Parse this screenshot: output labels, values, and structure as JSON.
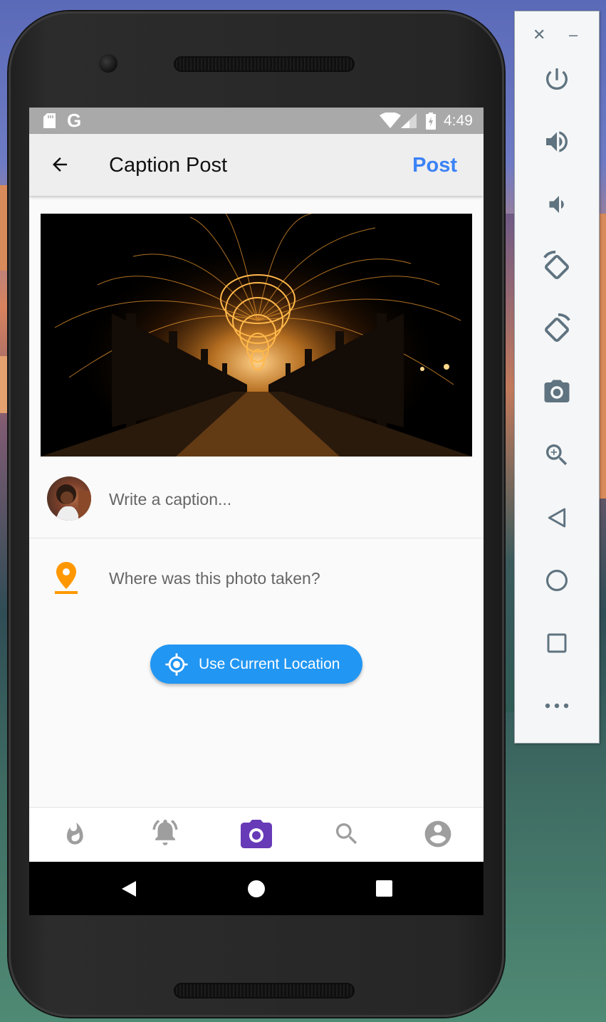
{
  "status_bar": {
    "carrier_icon": "G",
    "time": "4:49"
  },
  "app_bar": {
    "title": "Caption Post",
    "post_label": "Post"
  },
  "caption": {
    "placeholder": "Write a caption..."
  },
  "location": {
    "placeholder": "Where was this photo taken?",
    "current_location_label": "Use Current Location"
  },
  "bottom_nav": {
    "items": [
      "flame-icon",
      "bell-icon",
      "camera-icon",
      "search-icon",
      "account-icon"
    ],
    "active": "camera-icon",
    "active_color": "#673ab7",
    "inactive_color": "#9e9e9e"
  },
  "colors": {
    "accent_blue": "#2196f3",
    "post_blue": "#3b82f6",
    "pin_orange": "#ff9800"
  },
  "emulator_toolbar": {
    "items": [
      "close-icon",
      "minimize-icon",
      "power-icon",
      "volume-up-icon",
      "volume-down-icon",
      "rotate-left-icon",
      "rotate-right-icon",
      "screenshot-icon",
      "zoom-icon",
      "back-icon",
      "home-icon",
      "overview-icon",
      "more-icon"
    ]
  }
}
